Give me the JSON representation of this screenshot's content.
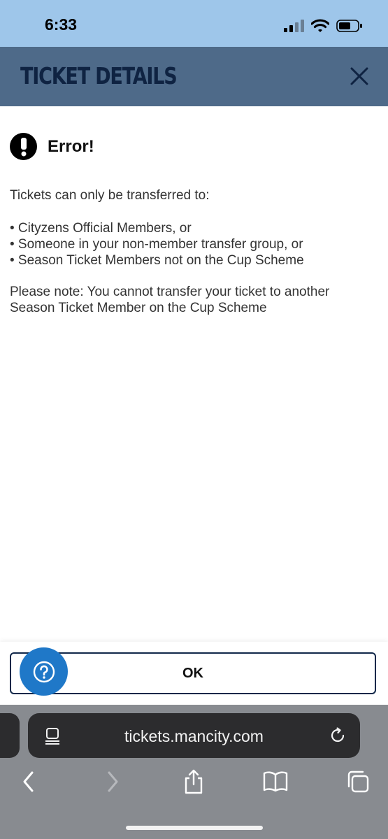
{
  "status_bar": {
    "time": "6:33"
  },
  "header": {
    "title": "TICKET DETAILS"
  },
  "error": {
    "title": "Error!",
    "intro": "Tickets can only be transferred to:",
    "bullets": [
      "• Cityzens Official Members, or",
      "• Someone in your non-member transfer group, or",
      "• Season Ticket Members not on the Cup Scheme"
    ],
    "note_line1": "Please note: You cannot transfer your ticket to another",
    "note_line2": "Season Ticket Member on the Cup Scheme"
  },
  "actions": {
    "ok_label": "OK"
  },
  "browser": {
    "url": "tickets.mancity.com"
  },
  "colors": {
    "status_bar": "#9ec6ea",
    "header": "#4e6a89",
    "header_title": "#0f2342",
    "help_button": "#1f78c8",
    "ok_border": "#12284a"
  },
  "icons": [
    "signal-icon",
    "wifi-icon",
    "battery-icon",
    "close-icon",
    "error-exclamation-icon",
    "help-icon",
    "page-menu-icon",
    "reload-icon",
    "back-icon",
    "forward-icon",
    "share-icon",
    "bookmarks-icon",
    "tabs-icon"
  ]
}
